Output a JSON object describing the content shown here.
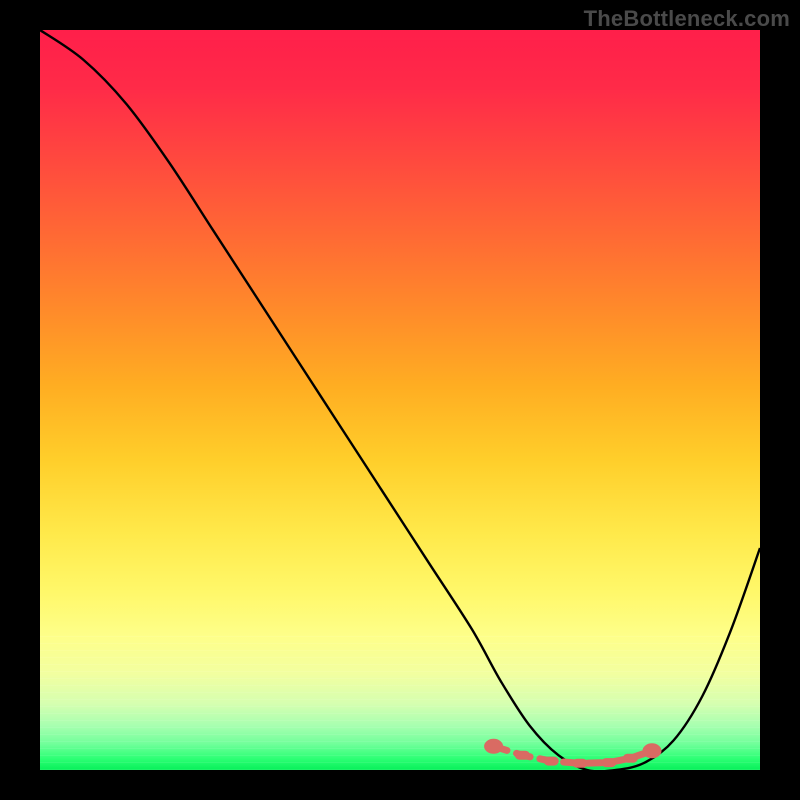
{
  "watermark": "TheBottleneck.com",
  "chart_data": {
    "type": "line",
    "title": "",
    "xlabel": "",
    "ylabel": "",
    "xlim": [
      0,
      100
    ],
    "ylim": [
      0,
      100
    ],
    "series": [
      {
        "name": "bottleneck-curve",
        "x": [
          0,
          6,
          12,
          18,
          24,
          30,
          36,
          42,
          48,
          54,
          60,
          64,
          68,
          72,
          76,
          80,
          84,
          88,
          92,
          96,
          100
        ],
        "values": [
          100,
          96,
          90,
          82,
          73,
          64,
          55,
          46,
          37,
          28,
          19,
          12,
          6,
          2,
          0,
          0,
          1,
          4,
          10,
          19,
          30
        ]
      }
    ],
    "markers": {
      "name": "optimal-range",
      "x": [
        63,
        67,
        71,
        75,
        79,
        82,
        85
      ],
      "values": [
        3.2,
        2.0,
        1.2,
        0.9,
        1.0,
        1.6,
        2.6
      ]
    },
    "background_gradient": {
      "top": "#ff1f4a",
      "bottom": "#08f05a",
      "meaning": "red = high bottleneck, green = low bottleneck"
    }
  }
}
